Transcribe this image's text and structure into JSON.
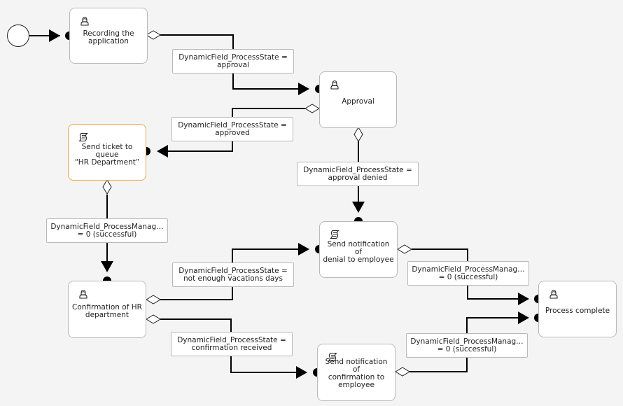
{
  "diagram": {
    "start_event": {
      "name": "start-event"
    },
    "activities": [
      {
        "id": "recording",
        "icon": "user-task-icon",
        "lines": [
          "Recording the",
          "application"
        ],
        "highlighted": false
      },
      {
        "id": "approval",
        "icon": "user-task-icon",
        "lines": [
          "Approval"
        ],
        "highlighted": false
      },
      {
        "id": "send-ticket",
        "icon": "script-task-icon",
        "lines": [
          "Send ticket to queue",
          "“HR Department”"
        ],
        "highlighted": true
      },
      {
        "id": "denial",
        "icon": "script-task-icon",
        "lines": [
          "Send notification of",
          "denial to employee"
        ],
        "highlighted": false
      },
      {
        "id": "hr-confirm",
        "icon": "user-task-icon",
        "lines": [
          "Confirmation of HR",
          "department"
        ],
        "highlighted": false
      },
      {
        "id": "confirm-notify",
        "icon": "script-task-icon",
        "lines": [
          "Send notification of",
          "confirmation to",
          "employee"
        ],
        "highlighted": false
      },
      {
        "id": "complete",
        "icon": "user-task-icon",
        "lines": [
          "Process complete"
        ],
        "highlighted": false
      }
    ],
    "transitions": [
      {
        "id": "t-approval",
        "lines": [
          "DynamicField_ProcessState =",
          "approval"
        ]
      },
      {
        "id": "t-approved",
        "lines": [
          "DynamicField_ProcessState =",
          "approved"
        ]
      },
      {
        "id": "t-denied",
        "lines": [
          "DynamicField_ProcessState =",
          "approval denied"
        ]
      },
      {
        "id": "t-ticket-ok",
        "lines": [
          "DynamicField_ProcessManag…",
          "= 0 (successful)"
        ]
      },
      {
        "id": "t-not-enough",
        "lines": [
          "DynamicField_ProcessState =",
          "not enough vacations days"
        ]
      },
      {
        "id": "t-confirm-received",
        "lines": [
          "DynamicField_ProcessState =",
          "confirmation received"
        ]
      },
      {
        "id": "t-denial-ok",
        "lines": [
          "DynamicField_ProcessManag…",
          "= 0 (successful)"
        ]
      },
      {
        "id": "t-confirm-ok",
        "lines": [
          "DynamicField_ProcessManag…",
          "= 0 (successful)"
        ]
      }
    ],
    "colors": {
      "line": "#000000",
      "node_border": "#b9b9b9",
      "highlight_border": "#f2a64a",
      "background": "#f4f4f4"
    }
  }
}
